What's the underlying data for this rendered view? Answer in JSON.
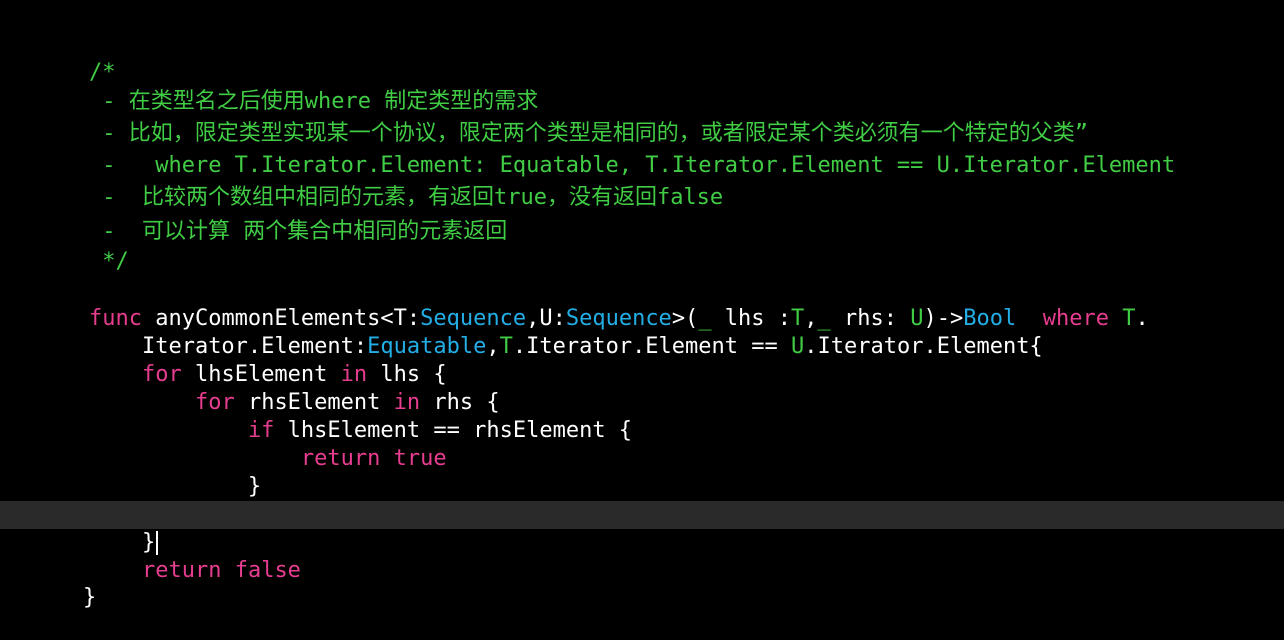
{
  "editor": {
    "colors": {
      "background": "#000000",
      "current_line": "#2a2a2a",
      "comment": "#41cc45",
      "keyword": "#e63d8f",
      "type": "#23aee6",
      "plain": "#ffffff"
    },
    "comment": {
      "l1": "/*",
      "l2": " - 在类型名之后使用where 制定类型的需求",
      "l3": " - 比如，限定类型实现某一个协议，限定两个类型是相同的，或者限定某个类必须有一个特定的父类”",
      "l4": " -   where T.Iterator.Element: Equatable, T.Iterator.Element == U.Iterator.Element",
      "l5": " -  比较两个数组中相同的元素，有返回true，没有返回false",
      "l6": " -  可以计算 两个集合中相同的元素返回",
      "l7": " */"
    },
    "code": {
      "l9": {
        "kw_func": "func",
        "p1": " anyCommonElements<T:",
        "t_seq1": "Sequence",
        "p2": ",U:",
        "t_seq2": "Sequence",
        "p3": ">(",
        "g_us1": "_",
        "p4": " lhs :",
        "g_T": "T",
        "p5": ",",
        "g_us2": "_",
        "p6": " rhs: ",
        "g_U": "U",
        "p7": ")->",
        "t_bool": "Bool",
        "p8": "  ",
        "kw_where": "where",
        "p9": " ",
        "g_T2": "T",
        "p10": "."
      },
      "l10": {
        "p1": "    Iterator.Element:",
        "t_eq": "Equatable",
        "p2": ",",
        "g_T": "T",
        "p3": ".Iterator.Element == ",
        "g_U": "U",
        "p4": ".Iterator.Element{"
      },
      "l11": {
        "p0": "    ",
        "kw_for": "for",
        "p1": " lhsElement ",
        "kw_in": "in",
        "p2": " lhs {"
      },
      "l12": {
        "p0": "        ",
        "kw_for": "for",
        "p1": " rhsElement ",
        "kw_in": "in",
        "p2": " rhs {"
      },
      "l13": {
        "p0": "            ",
        "kw_if": "if",
        "p1": " lhsElement == rhsElement {"
      },
      "l14": {
        "p0": "                ",
        "kw_return": "return",
        "p1": " ",
        "kw_true": "true"
      },
      "l15": {
        "p0": "            }"
      },
      "l16": {
        "p0": "        }"
      },
      "l17": {
        "p0": "    }"
      },
      "l18": {
        "p0": "    ",
        "kw_return": "return",
        "p1": " ",
        "kw_false": "false"
      },
      "l19": {
        "p0": "}"
      }
    }
  }
}
